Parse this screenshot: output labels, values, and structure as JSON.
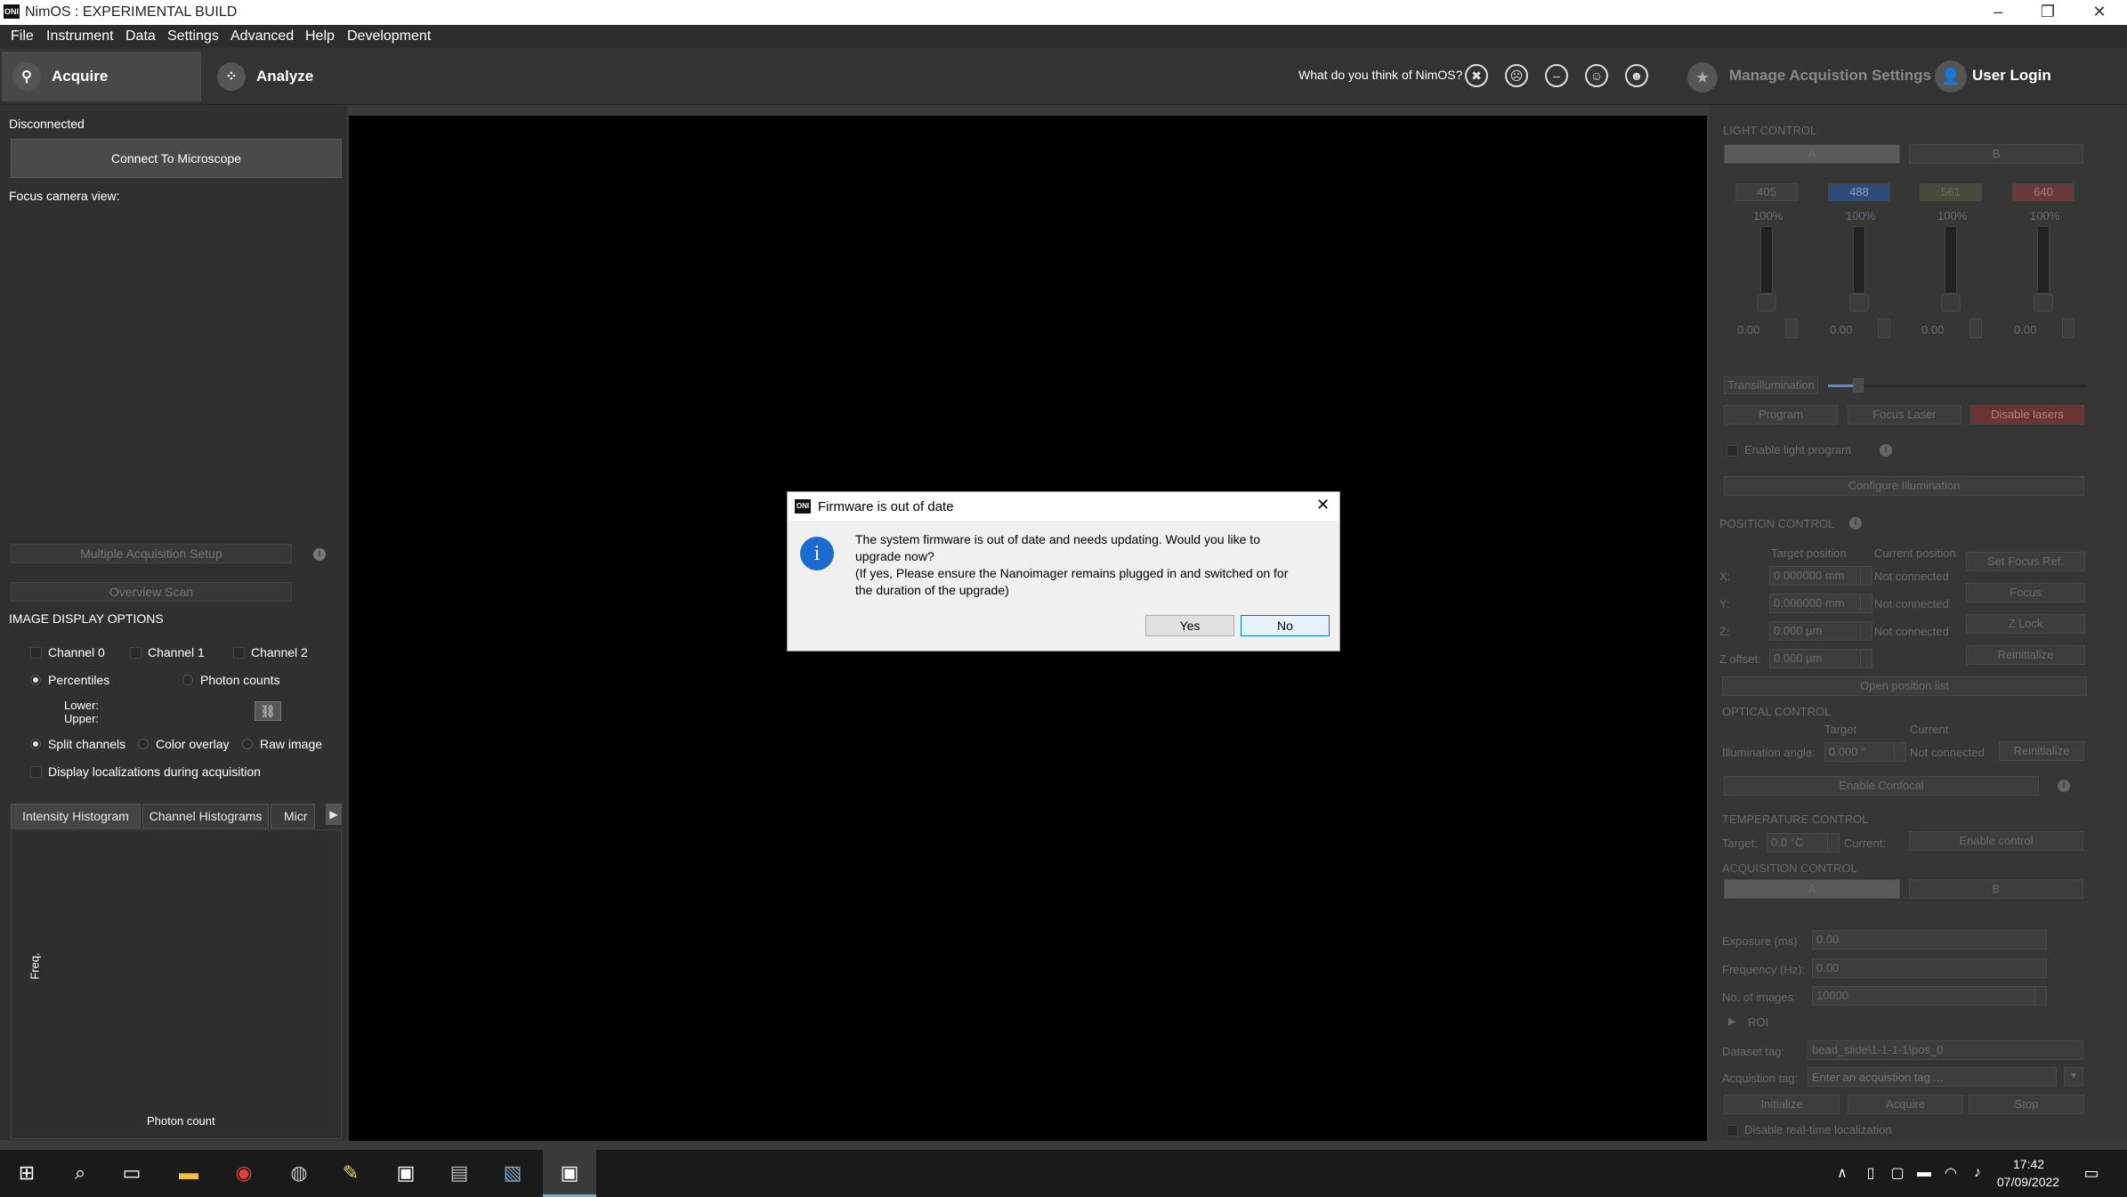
{
  "window": {
    "title": "NimOS : EXPERIMENTAL BUILD",
    "logo": "ONI"
  },
  "menu": [
    "File",
    "Instrument",
    "Data",
    "Settings",
    "Advanced",
    "Help",
    "Development"
  ],
  "toolbar": {
    "acquire": "Acquire",
    "analyze": "Analyze",
    "feedback": "What do you think of NimOS?",
    "manage": "Manage Acquistion Settings",
    "login": "User Login"
  },
  "left": {
    "status": "Disconnected",
    "connect": "Connect To Microscope",
    "focus_view": "Focus camera view:",
    "multi": "Multiple Acquisition Setup",
    "overview": "Overview Scan",
    "display_title": "IMAGE DISPLAY OPTIONS",
    "channels": [
      "Channel 0",
      "Channel 1",
      "Channel 2"
    ],
    "percentiles": "Percentiles",
    "photon_counts": "Photon counts",
    "lower": "Lower:",
    "upper": "Upper:",
    "split": "Split channels",
    "overlay": "Color overlay",
    "raw": "Raw image",
    "display_loc": "Display localizations during acquisition",
    "tabs": [
      "Intensity Histogram",
      "Channel Histograms",
      "Micr"
    ],
    "freq": "Freq.",
    "photon_count": "Photon count"
  },
  "right": {
    "light_title": "LIGHT CONTROL",
    "ab": [
      "A",
      "B"
    ],
    "lasers": [
      {
        "wl": "405",
        "pct": "100%",
        "val": "0.00",
        "color": "#3e3e3e"
      },
      {
        "wl": "488",
        "pct": "100%",
        "val": "0.00",
        "color": "#2c4a7a"
      },
      {
        "wl": "561",
        "pct": "100%",
        "val": "0.00",
        "color": "#4a4a3a"
      },
      {
        "wl": "640",
        "pct": "100%",
        "val": "0.00",
        "color": "#6a3a3a"
      }
    ],
    "transillumination": "Transillumination",
    "program": "Program",
    "focus_laser": "Focus Laser",
    "disable_lasers": "Disable lasers",
    "enable_light": "Enable light program",
    "configure": "Configure Illumination",
    "position_title": "POSITION CONTROL",
    "target_pos": "Target position",
    "current_pos": "Current position",
    "pos_rows": [
      {
        "axis": "X:",
        "val": "0.000000 mm",
        "cur": "Not connected",
        "btn": "Set Focus Ref."
      },
      {
        "axis": "Y:",
        "val": "0.000000 mm",
        "cur": "Not connected",
        "btn": "Focus"
      },
      {
        "axis": "Z:",
        "val": "0.000 µm",
        "cur": "Not connected",
        "btn": "Z Lock"
      },
      {
        "axis": "Z offset:",
        "val": "0.000 µm",
        "cur": "",
        "btn": "Reinitialize"
      }
    ],
    "open_pos": "Open position list",
    "optical_title": "OPTICAL CONTROL",
    "target": "Target",
    "current": "Current",
    "illum_angle": "Illumination angle:",
    "angle_val": "0.000 °",
    "not_connected": "Not connected",
    "reinit": "Reinitialize",
    "confocal": "Enable Confocal",
    "temp_title": "TEMPERATURE CONTROL",
    "temp_target": "Target:",
    "temp_val": "0.0 °C",
    "temp_current": "Current:",
    "enable_control": "Enable control",
    "acq_title": "ACQUISITION CONTROL",
    "exposure": "Exposure (ms)",
    "exposure_val": "0.00",
    "frequency": "Frequency (Hz):",
    "frequency_val": "0.00",
    "nimages": "No. of images",
    "nimages_val": "10000",
    "roi": "ROI",
    "dataset_tag": "Dataset tag:",
    "dataset_val": "bead_slide\\1-1-1-1\\pos_0",
    "acq_tag": "Acquistion tag:",
    "acq_placeholder": "Enter an acquistion tag ...",
    "initialize": "Initialize",
    "acquire": "Acquire",
    "stop": "Stop",
    "disable_rt": "Disable real-time localization"
  },
  "dialog": {
    "title": "Firmware is out of date",
    "line1": "The system firmware is out of date and needs updating.  Would you like to",
    "line2": "upgrade now?",
    "line3": "(If yes, Please ensure the Nanoimager remains plugged in and switched on for",
    "line4": "the duration of the upgrade)",
    "yes": "Yes",
    "no": "No"
  },
  "taskbar": {
    "time": "17:42",
    "date": "07/09/2022"
  }
}
